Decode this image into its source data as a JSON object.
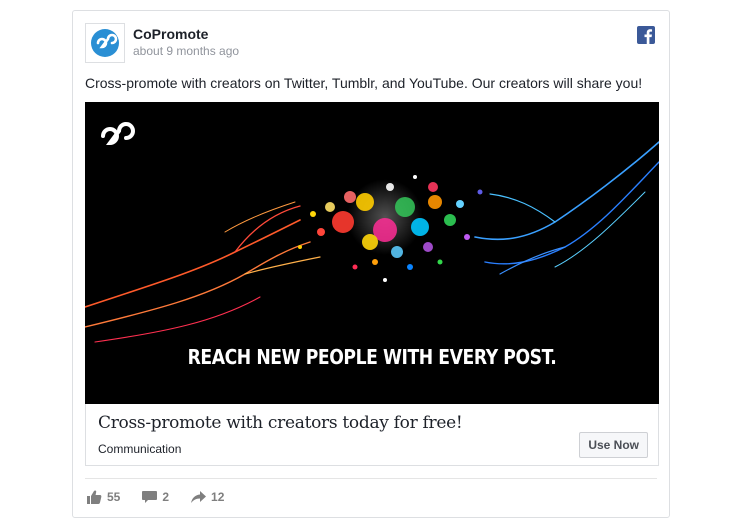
{
  "post": {
    "page_name": "CoPromote",
    "timestamp": "about 9 months ago",
    "text": "Cross-promote with creators on Twitter, Tumblr, and YouTube. Our creators will share you!",
    "banner_text": "REACH NEW PEOPLE WITH EVERY POST."
  },
  "link": {
    "title": "Cross-promote with creators today for free!",
    "domain": "Communication",
    "cta_label": "Use Now"
  },
  "actions": {
    "likes": "55",
    "comments": "2",
    "shares": "12"
  },
  "icons": {
    "brand": "copromote-logo-icon",
    "network": "facebook-icon",
    "like": "thumbs-up-icon",
    "comment": "comment-icon",
    "share": "share-arrow-icon"
  },
  "colors": {
    "brand_blue": "#2a8fd4",
    "facebook_blue": "#3b5998",
    "meta_gray": "#90949c"
  }
}
